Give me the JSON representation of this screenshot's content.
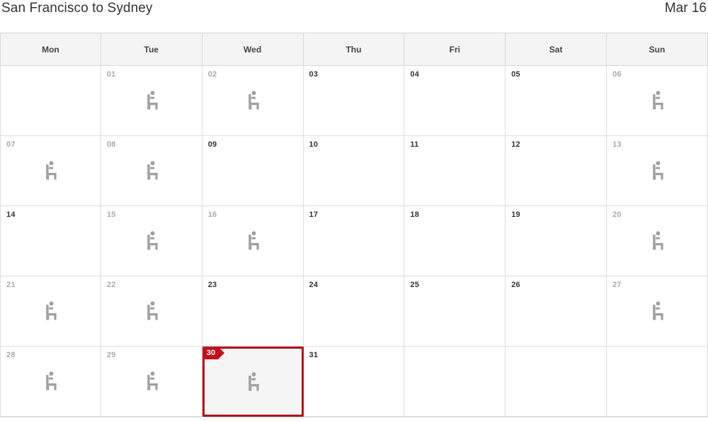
{
  "header": {
    "route_title": "San Francisco to Sydney",
    "month_label": "Mar 16"
  },
  "calendar": {
    "weekday_headers": [
      "Mon",
      "Tue",
      "Wed",
      "Thu",
      "Fri",
      "Sat",
      "Sun"
    ],
    "selected_day": "30",
    "icon_name": "airline-seat-icon",
    "colors": {
      "selected_border": "#b50e1a",
      "badge": "#c2101c",
      "selected_background": "#f5f5f5",
      "muted_date": "#aaaaaa",
      "available_date": "#333333",
      "header_background": "#f4f4f4",
      "grid_border": "#dddddd",
      "icon": "#a0a0a0"
    },
    "weeks": [
      [
        {
          "day": "",
          "state": "blank",
          "icon": false,
          "selected": false
        },
        {
          "day": "01",
          "state": "muted",
          "icon": true,
          "selected": false
        },
        {
          "day": "02",
          "state": "muted",
          "icon": true,
          "selected": false
        },
        {
          "day": "03",
          "state": "available",
          "icon": false,
          "selected": false
        },
        {
          "day": "04",
          "state": "available",
          "icon": false,
          "selected": false
        },
        {
          "day": "05",
          "state": "available",
          "icon": false,
          "selected": false
        },
        {
          "day": "06",
          "state": "muted",
          "icon": true,
          "selected": false
        }
      ],
      [
        {
          "day": "07",
          "state": "muted",
          "icon": true,
          "selected": false
        },
        {
          "day": "08",
          "state": "muted",
          "icon": true,
          "selected": false
        },
        {
          "day": "09",
          "state": "available",
          "icon": false,
          "selected": false
        },
        {
          "day": "10",
          "state": "available",
          "icon": false,
          "selected": false
        },
        {
          "day": "11",
          "state": "available",
          "icon": false,
          "selected": false
        },
        {
          "day": "12",
          "state": "available",
          "icon": false,
          "selected": false
        },
        {
          "day": "13",
          "state": "muted",
          "icon": true,
          "selected": false
        }
      ],
      [
        {
          "day": "14",
          "state": "available",
          "icon": false,
          "selected": false
        },
        {
          "day": "15",
          "state": "muted",
          "icon": true,
          "selected": false
        },
        {
          "day": "16",
          "state": "muted",
          "icon": true,
          "selected": false
        },
        {
          "day": "17",
          "state": "available",
          "icon": false,
          "selected": false
        },
        {
          "day": "18",
          "state": "available",
          "icon": false,
          "selected": false
        },
        {
          "day": "19",
          "state": "available",
          "icon": false,
          "selected": false
        },
        {
          "day": "20",
          "state": "muted",
          "icon": true,
          "selected": false
        }
      ],
      [
        {
          "day": "21",
          "state": "muted",
          "icon": true,
          "selected": false
        },
        {
          "day": "22",
          "state": "muted",
          "icon": true,
          "selected": false
        },
        {
          "day": "23",
          "state": "available",
          "icon": false,
          "selected": false
        },
        {
          "day": "24",
          "state": "available",
          "icon": false,
          "selected": false
        },
        {
          "day": "25",
          "state": "available",
          "icon": false,
          "selected": false
        },
        {
          "day": "26",
          "state": "available",
          "icon": false,
          "selected": false
        },
        {
          "day": "27",
          "state": "muted",
          "icon": true,
          "selected": false
        }
      ],
      [
        {
          "day": "28",
          "state": "muted",
          "icon": true,
          "selected": false
        },
        {
          "day": "29",
          "state": "muted",
          "icon": true,
          "selected": false
        },
        {
          "day": "30",
          "state": "available",
          "icon": true,
          "selected": true
        },
        {
          "day": "31",
          "state": "available",
          "icon": false,
          "selected": false
        },
        {
          "day": "",
          "state": "blank",
          "icon": false,
          "selected": false
        },
        {
          "day": "",
          "state": "blank",
          "icon": false,
          "selected": false
        },
        {
          "day": "",
          "state": "blank",
          "icon": false,
          "selected": false
        }
      ]
    ]
  }
}
